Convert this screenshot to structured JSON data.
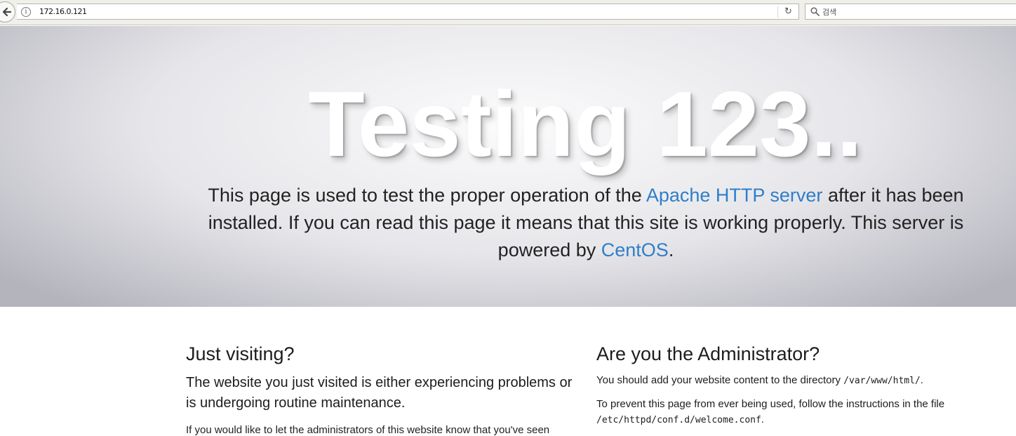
{
  "browser": {
    "url": "172.16.0.121",
    "search_placeholder": "검색",
    "icons": {
      "back": "back-arrow-icon",
      "info": "info-icon",
      "reload": "reload-icon",
      "search": "search-icon"
    }
  },
  "hero": {
    "title": "Testing 123..",
    "lead_before": "This page is used to test the proper operation of the ",
    "lead_link_apache": "Apache HTTP server",
    "lead_middle": " after it has been installed. If you can read this page it means that this site is working properly. This server is powered by ",
    "lead_link_centos": "CentOS",
    "lead_end": "."
  },
  "visitor": {
    "heading": "Just visiting?",
    "lead": "The website you just visited is either experiencing problems or is undergoing routine maintenance.",
    "cut_text": "If you would like to let the administrators of this website know that you've seen"
  },
  "admin": {
    "heading": "Are you the Administrator?",
    "p1_text": "You should add your website content to the directory ",
    "p1_code": "/var/www/html/",
    "p1_end": ".",
    "p2_text": "To prevent this page from ever being used, follow the instructions in the file ",
    "p2_code": "/etc/httpd/conf.d/welcome.conf",
    "p2_end": "."
  },
  "colors": {
    "link": "#2f7ec9",
    "text": "#1d1d1d"
  }
}
